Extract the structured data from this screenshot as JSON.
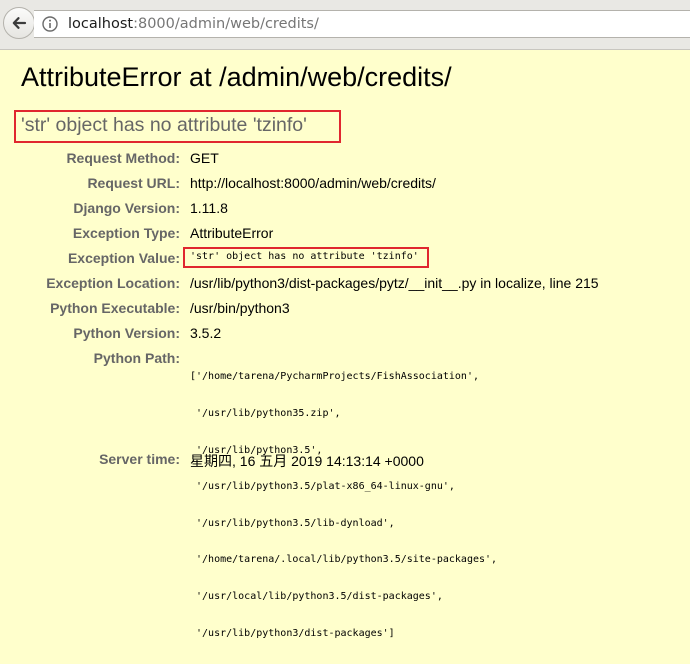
{
  "browser": {
    "url_host": "localhost",
    "url_rest": ":8000/admin/web/credits/"
  },
  "error": {
    "title": "AttributeError at /admin/web/credits/",
    "message": "'str' object has no attribute 'tzinfo'"
  },
  "meta": {
    "request_method": {
      "label": "Request Method:",
      "value": "GET"
    },
    "request_url": {
      "label": "Request URL:",
      "value": "http://localhost:8000/admin/web/credits/"
    },
    "django_version": {
      "label": "Django Version:",
      "value": "1.11.8"
    },
    "exception_type": {
      "label": "Exception Type:",
      "value": "AttributeError"
    },
    "exception_value": {
      "label": "Exception Value:",
      "value": "'str' object has no attribute 'tzinfo'"
    },
    "exception_location": {
      "label": "Exception Location:",
      "value": "/usr/lib/python3/dist-packages/pytz/__init__.py in localize, line 215"
    },
    "python_executable": {
      "label": "Python Executable:",
      "value": "/usr/bin/python3"
    },
    "python_version": {
      "label": "Python Version:",
      "value": "3.5.2"
    },
    "python_path": {
      "label": "Python Path:",
      "lines": [
        "['/home/tarena/PycharmProjects/FishAssociation',",
        " '/usr/lib/python35.zip',",
        " '/usr/lib/python3.5',",
        " '/usr/lib/python3.5/plat-x86_64-linux-gnu',",
        " '/usr/lib/python3.5/lib-dynload',",
        " '/home/tarena/.local/lib/python3.5/site-packages',",
        " '/usr/local/lib/python3.5/dist-packages',",
        " '/usr/lib/python3/dist-packages']"
      ]
    },
    "server_time": {
      "label": "Server time:",
      "value": "星期四, 16 五月 2019 14:13:14 +0000"
    }
  },
  "colors": {
    "page_bg": "#ffffcc",
    "label_gray": "#666666",
    "highlight_red": "#e0262f"
  },
  "icons": {
    "back": "back-arrow-icon",
    "info": "info-icon"
  }
}
